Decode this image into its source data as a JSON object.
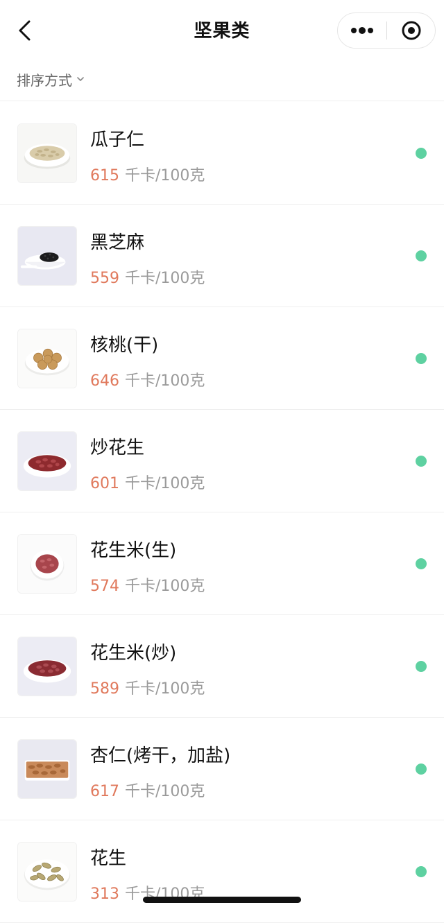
{
  "navbar": {
    "title": "坚果类"
  },
  "sort": {
    "label": "排序方式"
  },
  "items": [
    {
      "name": "瓜子仁",
      "calories": "615",
      "unit": "千卡/100克"
    },
    {
      "name": "黑芝麻",
      "calories": "559",
      "unit": "千卡/100克"
    },
    {
      "name": "核桃(干)",
      "calories": "646",
      "unit": "千卡/100克"
    },
    {
      "name": "炒花生",
      "calories": "601",
      "unit": "千卡/100克"
    },
    {
      "name": "花生米(生)",
      "calories": "574",
      "unit": "千卡/100克"
    },
    {
      "name": "花生米(炒)",
      "calories": "589",
      "unit": "千卡/100克"
    },
    {
      "name": "杏仁(烤干，加盐)",
      "calories": "617",
      "unit": "千卡/100克"
    },
    {
      "name": "花生",
      "calories": "313",
      "unit": "千卡/100克"
    }
  ],
  "colors": {
    "calorie_value": "#e0795c",
    "status_dot": "#5ed1a1"
  }
}
